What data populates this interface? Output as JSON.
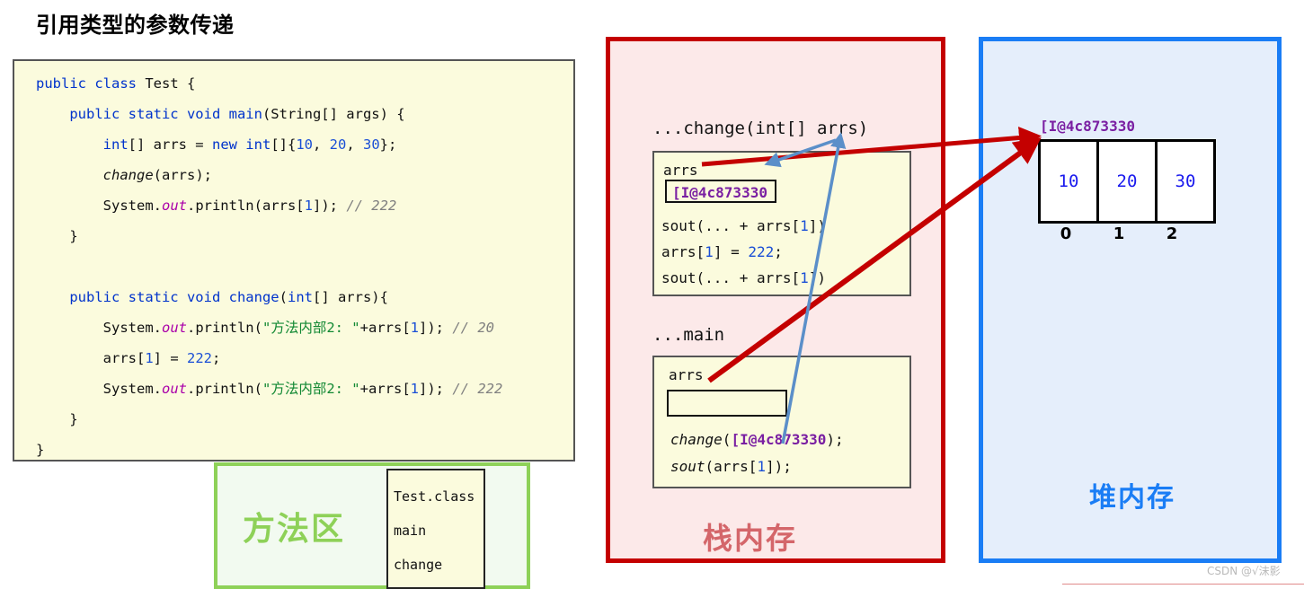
{
  "title": "引用类型的参数传递",
  "code": {
    "lines": [
      [
        {
          "t": "public class ",
          "c": "kw"
        },
        {
          "t": "Test {",
          "c": ""
        }
      ],
      [
        {
          "t": "    public static void ",
          "c": "kw"
        },
        {
          "t": "main",
          "c": "kw"
        },
        {
          "t": "(String[] args) {",
          "c": ""
        }
      ],
      [
        {
          "t": "        ",
          "c": ""
        },
        {
          "t": "int",
          "c": "kw"
        },
        {
          "t": "[] arrs = ",
          "c": ""
        },
        {
          "t": "new int",
          "c": "kw"
        },
        {
          "t": "[]{",
          "c": ""
        },
        {
          "t": "10",
          "c": "num"
        },
        {
          "t": ", ",
          "c": ""
        },
        {
          "t": "20",
          "c": "num"
        },
        {
          "t": ", ",
          "c": ""
        },
        {
          "t": "30",
          "c": "num"
        },
        {
          "t": "};",
          "c": ""
        }
      ],
      [
        {
          "t": "        ",
          "c": ""
        },
        {
          "t": "change",
          "c": "it"
        },
        {
          "t": "(arrs);",
          "c": ""
        }
      ],
      [
        {
          "t": "        System.",
          "c": ""
        },
        {
          "t": "out",
          "c": "pur"
        },
        {
          "t": ".println(arrs[",
          "c": ""
        },
        {
          "t": "1",
          "c": "num"
        },
        {
          "t": "]); ",
          "c": ""
        },
        {
          "t": "// 222",
          "c": "cmt"
        }
      ],
      [
        {
          "t": "    }",
          "c": ""
        }
      ],
      [
        {
          "t": "",
          "c": ""
        }
      ],
      [
        {
          "t": "    public static void ",
          "c": "kw"
        },
        {
          "t": "change",
          "c": "kw"
        },
        {
          "t": "(",
          "c": ""
        },
        {
          "t": "int",
          "c": "kw"
        },
        {
          "t": "[] arrs){",
          "c": ""
        }
      ],
      [
        {
          "t": "        System.",
          "c": ""
        },
        {
          "t": "out",
          "c": "pur"
        },
        {
          "t": ".println(",
          "c": ""
        },
        {
          "t": "\"方法内部2: \"",
          "c": "str"
        },
        {
          "t": "+arrs[",
          "c": ""
        },
        {
          "t": "1",
          "c": "num"
        },
        {
          "t": "]); ",
          "c": ""
        },
        {
          "t": "// 20",
          "c": "cmt"
        }
      ],
      [
        {
          "t": "        arrs[",
          "c": ""
        },
        {
          "t": "1",
          "c": "num"
        },
        {
          "t": "] = ",
          "c": ""
        },
        {
          "t": "222",
          "c": "num"
        },
        {
          "t": ";",
          "c": ""
        }
      ],
      [
        {
          "t": "        System.",
          "c": ""
        },
        {
          "t": "out",
          "c": "pur"
        },
        {
          "t": ".println(",
          "c": ""
        },
        {
          "t": "\"方法内部2: \"",
          "c": "str"
        },
        {
          "t": "+arrs[",
          "c": ""
        },
        {
          "t": "1",
          "c": "num"
        },
        {
          "t": "]); ",
          "c": ""
        },
        {
          "t": "// 222",
          "c": "cmt"
        }
      ],
      [
        {
          "t": "    }",
          "c": ""
        }
      ],
      [
        {
          "t": "}",
          "c": ""
        }
      ]
    ]
  },
  "method_area": {
    "label": "方法区",
    "entries": [
      "Test.class",
      "main",
      "change"
    ]
  },
  "stack": {
    "label": "栈内存",
    "change_frame": {
      "title": "...change(int[] arrs)",
      "var_name": "arrs",
      "var_value": "[I@4c873330",
      "statements": [
        "sout(... + arrs[1])",
        "arrs[1] = 222;",
        "sout(... + arrs[1])"
      ]
    },
    "main_frame": {
      "title": "...main",
      "var_name": "arrs",
      "var_value": "",
      "statements": [
        "change([I@4c873330);",
        "sout(arrs[1]);"
      ],
      "call_method": "change",
      "call_arg": "[I@4c873330"
    }
  },
  "heap": {
    "label": "堆内存",
    "address": "[I@4c873330",
    "cells": [
      "10",
      "20",
      "30"
    ],
    "indices": [
      "0",
      "1",
      "2"
    ]
  },
  "watermark": "CSDN @√沫影",
  "colors": {
    "stack_border": "#c40000",
    "stack_bg": "#fce9e9",
    "heap_border": "#1a7df5",
    "heap_bg": "#e5eefb",
    "method_area_border": "#8ed158",
    "arrow_red": "#c40000",
    "arrow_blue": "#5b8fc9",
    "code_bg": "#fbfbdd"
  }
}
